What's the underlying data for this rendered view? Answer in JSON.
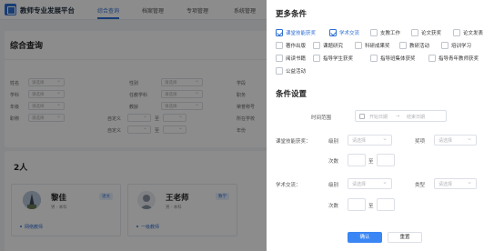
{
  "app": {
    "title": "教师专业发展平台"
  },
  "nav": [
    "综合查询",
    "档案管理",
    "专项管理",
    "系统管理"
  ],
  "query_page": {
    "title": "综合查询",
    "filter_labels": [
      "姓名",
      "性别",
      "学段",
      "学科",
      "年级",
      "任教学科",
      "职务",
      "职称",
      "教龄",
      "荣誉称号",
      "所在学校",
      "年份"
    ],
    "select_placeholder": "请选择",
    "range_labels": [
      "自定义",
      "自定义"
    ],
    "range_sep": "至",
    "result_count": "2人",
    "people": [
      {
        "name": "黎佳",
        "tag": "语文",
        "sub": "男 · 本科",
        "link": "网络教师"
      },
      {
        "name": "王老师",
        "tag": "数学",
        "sub": "男 · 本科",
        "link": "一级教师"
      }
    ]
  },
  "drawer": {
    "more_title": "更多条件",
    "checkboxes": [
      {
        "label": "课堂技能获奖",
        "checked": true
      },
      {
        "label": "学术交流",
        "checked": true
      },
      {
        "label": "支教工作",
        "checked": false
      },
      {
        "label": "论文获奖",
        "checked": false
      },
      {
        "label": "论文发表",
        "checked": false
      },
      {
        "label": "著作出版",
        "checked": false
      },
      {
        "label": "课题研究",
        "checked": false
      },
      {
        "label": "科研成果奖",
        "checked": false
      },
      {
        "label": "教研活动",
        "checked": false
      },
      {
        "label": "培训学习",
        "checked": false
      },
      {
        "label": "阅读书籍",
        "checked": false
      },
      {
        "label": "指导学生获奖",
        "checked": false
      },
      {
        "label": "指导班集体获奖",
        "checked": false
      },
      {
        "label": "指导青年教师获奖",
        "checked": false
      },
      {
        "label": "公益活动",
        "checked": false
      }
    ],
    "settings_title": "条件设置",
    "time_range_label": "时间范围",
    "start_placeholder": "开始日期",
    "date_sep": "→",
    "end_placeholder": "结束日期",
    "groups": [
      {
        "label": "课堂技能获奖：",
        "level_label": "级别",
        "grade_label": "奖项",
        "count_label": "次数",
        "sep": "至",
        "level_placeholder": "请选择",
        "grade_placeholder": "请选择"
      },
      {
        "label": "学术交流：",
        "level_label": "级别",
        "grade_label": "类型",
        "count_label": "次数",
        "sep": "至",
        "level_placeholder": "请选择",
        "grade_placeholder": "请选择"
      }
    ],
    "confirm_label": "确认",
    "reset_label": "重置"
  }
}
